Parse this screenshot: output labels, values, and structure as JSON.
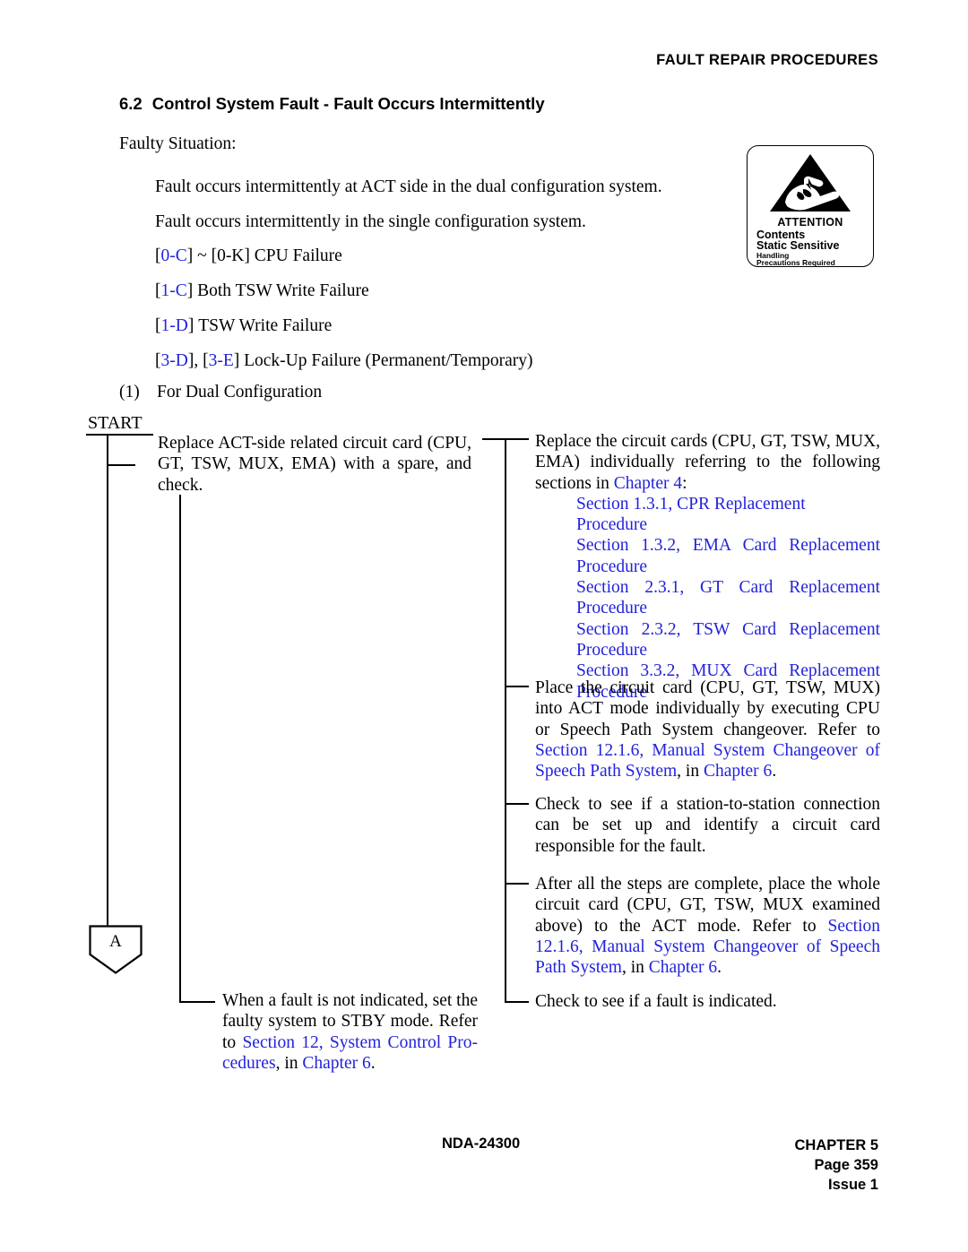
{
  "header": {
    "running_head": "FAULT REPAIR PROCEDURES"
  },
  "section": {
    "number": "6.2",
    "title": "Control System Fault - Fault Occurs Intermittently"
  },
  "intro": {
    "faulty_situation_label": "Faulty Situation:",
    "line1": "Fault occurs intermittently at ACT side in the dual configuration system.",
    "line2": "Fault occurs intermittently in the single configuration system."
  },
  "fault_codes": [
    {
      "code1": "0-C",
      "separator": " ~ ",
      "code2": "0-K",
      "description": "CPU Failure"
    },
    {
      "code1": "1-C",
      "description": "Both TSW Write Failure"
    },
    {
      "code1": "1-D",
      "description": "TSW Write Failure"
    },
    {
      "code1": "3-D",
      "separator": ", ",
      "code2": "3-E",
      "description": "Lock-Up Failure (Permanent/Temporary)"
    }
  ],
  "numbered_item": {
    "number": "(1)",
    "text": "For Dual Configuration"
  },
  "flowchart": {
    "start_label": "START",
    "connector_label": "A",
    "left_step_1": "Replace ACT-side related circuit card (CPU, GT, TSW, MUX, EMA) with a spare, and check.",
    "left_step_2_pre": "When a fault is not indicated, set the faulty system to STBY mode. Refer to ",
    "left_step_2_ref": "Section 12, System Control Pro-cedures",
    "left_step_2_mid": ", in ",
    "left_step_2_ref2": "Chapter 6",
    "left_step_2_end": ".",
    "right_step_1": {
      "lead_pre": "Replace the circuit cards (CPU, GT, TSW, MUX, EMA) individually referring to the following sections in ",
      "lead_ref": "Chapter 4",
      "lead_end": ":",
      "refs": [
        "Section 1.3.1, CPR Replacement Procedure",
        "Section 1.3.2, EMA Card Replacement Procedure",
        "Section 2.3.1, GT Card Replacement Procedure",
        "Section 2.3.2, TSW Card Replacement Procedure",
        "Section 3.3.2, MUX Card Replacement Procedure"
      ]
    },
    "right_step_2_pre": "Place the circuit card (CPU, GT, TSW, MUX) into ACT mode individually by executing CPU or Speech Path System changeover. Refer to ",
    "right_step_2_ref": "Section 12.1.6, Manual System Changeover of Speech Path System",
    "right_step_2_mid": ", in ",
    "right_step_2_ref2": "Chapter 6",
    "right_step_2_end": ".",
    "right_step_3": "Check to see if a station-to-station connection can be set up and identify a circuit card responsible for the fault.",
    "right_step_4_pre": "After all the steps are complete, place the whole circuit card (CPU, GT, TSW, MUX examined above) to the ACT mode. Refer to ",
    "right_step_4_ref": "Section 12.1.6, Manual System Changeover of Speech Path System",
    "right_step_4_mid": ", in ",
    "right_step_4_ref2": "Chapter 6",
    "right_step_4_end": ".",
    "right_step_5": "Check to see if a fault is indicated."
  },
  "esd_label": {
    "attention": "ATTENTION",
    "line2": "Contents",
    "line3": "Static Sensitive",
    "line4": "Handling",
    "line5": "Precautions Required"
  },
  "footer": {
    "document_number": "NDA-24300",
    "chapter": "CHAPTER  5",
    "page": "Page  359",
    "issue": "Issue  1"
  },
  "colors": {
    "link_blue": "#2222dd",
    "text_black": "#000000"
  }
}
